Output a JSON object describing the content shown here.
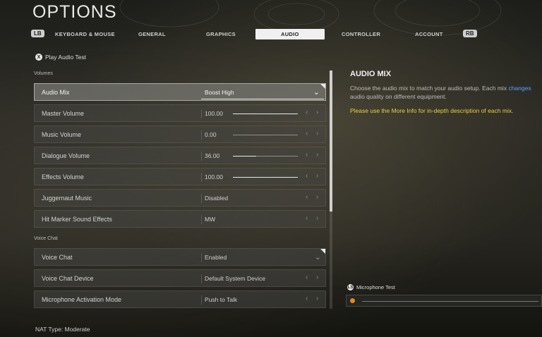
{
  "header": {
    "title": "OPTIONS"
  },
  "tabs": {
    "lb": "LB",
    "rb": "RB",
    "items": [
      "KEYBOARD & MOUSE",
      "GENERAL",
      "GRAPHICS",
      "AUDIO",
      "CONTROLLER",
      "ACCOUNT"
    ],
    "active": "AUDIO"
  },
  "play_audio_test": {
    "button": "X",
    "label": "Play Audio Test"
  },
  "sections": {
    "volumes": "Volumes",
    "voice_chat": "Voice Chat"
  },
  "settings": {
    "audio_mix": {
      "label": "Audio Mix",
      "value": "Boost High"
    },
    "master_volume": {
      "label": "Master Volume",
      "value": "100.00",
      "level": 1.0
    },
    "music_volume": {
      "label": "Music Volume",
      "value": "0.00",
      "level": 0.0
    },
    "dialogue_volume": {
      "label": "Dialogue Volume",
      "value": "36.00",
      "level": 0.36
    },
    "effects_volume": {
      "label": "Effects Volume",
      "value": "100.00",
      "level": 1.0
    },
    "juggernaut_music": {
      "label": "Juggernaut Music",
      "value": "Disabled"
    },
    "hit_marker": {
      "label": "Hit Marker Sound Effects",
      "value": "MW"
    },
    "voice_chat": {
      "label": "Voice Chat",
      "value": "Enabled"
    },
    "voice_chat_device": {
      "label": "Voice Chat Device",
      "value": "Default System Device"
    },
    "mic_activation": {
      "label": "Microphone Activation Mode",
      "value": "Push to Talk"
    }
  },
  "info": {
    "title": "AUDIO MIX",
    "desc_a": "Choose the audio mix to match your audio setup. Each mix ",
    "desc_link": "changes",
    "desc_b": "audio quality on different equipment.",
    "note": "Please use the More Info for in-depth description of each mix."
  },
  "mic_test": {
    "label": "Microphone Test",
    "button": "LS"
  },
  "footer": {
    "nat": "NAT Type: Moderate"
  },
  "colors": {
    "accent_yellow": "#e7d23c",
    "link_blue": "#5aa0ff",
    "mic_orange": "#e08a1e"
  }
}
